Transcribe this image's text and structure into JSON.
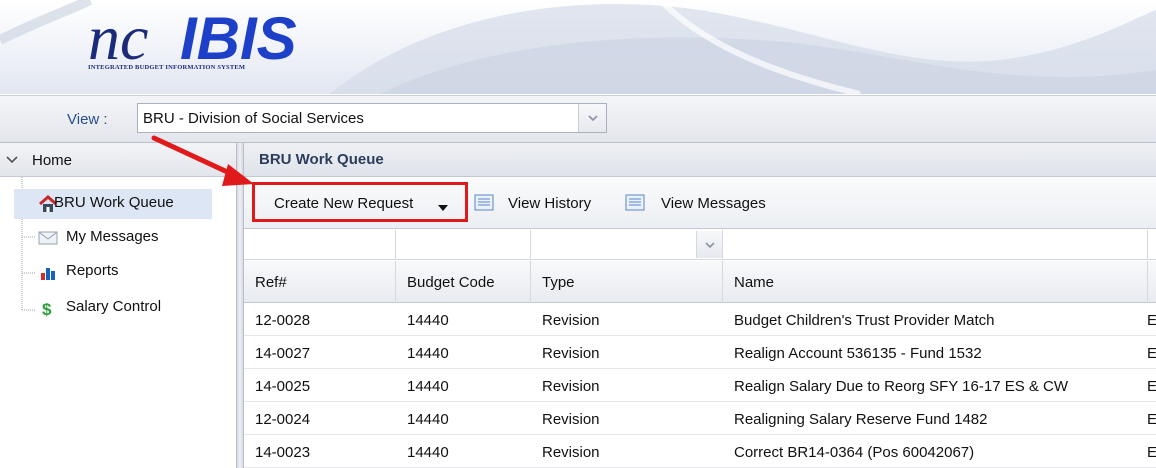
{
  "header": {
    "logo_text": "ncIBIS",
    "logo_tagline": "INTEGRATED BUDGET INFORMATION SYSTEM"
  },
  "viewbar": {
    "label": "View :",
    "selected_value": "BRU - Division of Social Services"
  },
  "sidebar": {
    "root_label": "Home",
    "items": [
      {
        "label": "BRU Work Queue",
        "icon": "home-icon",
        "selected": true
      },
      {
        "label": "My Messages",
        "icon": "envelope-icon",
        "selected": false
      },
      {
        "label": "Reports",
        "icon": "bar-chart-icon",
        "selected": false
      },
      {
        "label": "Salary Control",
        "icon": "dollar-icon",
        "selected": false
      }
    ]
  },
  "main": {
    "title": "BRU Work Queue",
    "toolbar": {
      "create_label": "Create New Request",
      "history_label": "View History",
      "messages_label": "View Messages"
    },
    "columns": [
      "Ref#",
      "Budget Code",
      "Type",
      "Name"
    ],
    "rows": [
      {
        "ref": "12-0028",
        "code": "14440",
        "type": "Revision",
        "name": "Budget Children's Trust Provider Match",
        "status": "E"
      },
      {
        "ref": "14-0027",
        "code": "14440",
        "type": "Revision",
        "name": "Realign Account 536135 - Fund 1532",
        "status": "E"
      },
      {
        "ref": "14-0025",
        "code": "14440",
        "type": "Revision",
        "name": "Realign Salary Due to Reorg SFY 16-17 ES & CW",
        "status": "E"
      },
      {
        "ref": "12-0024",
        "code": "14440",
        "type": "Revision",
        "name": "Realigning Salary Reserve Fund 1482",
        "status": "E"
      },
      {
        "ref": "14-0023",
        "code": "14440",
        "type": "Revision",
        "name": "Correct BR14-0364 (Pos 60042067)",
        "status": "E"
      }
    ]
  },
  "colors": {
    "highlight_red": "#e0191b",
    "logo_blue": "#1b2b7a",
    "selected_bg": "#dce6f5"
  }
}
